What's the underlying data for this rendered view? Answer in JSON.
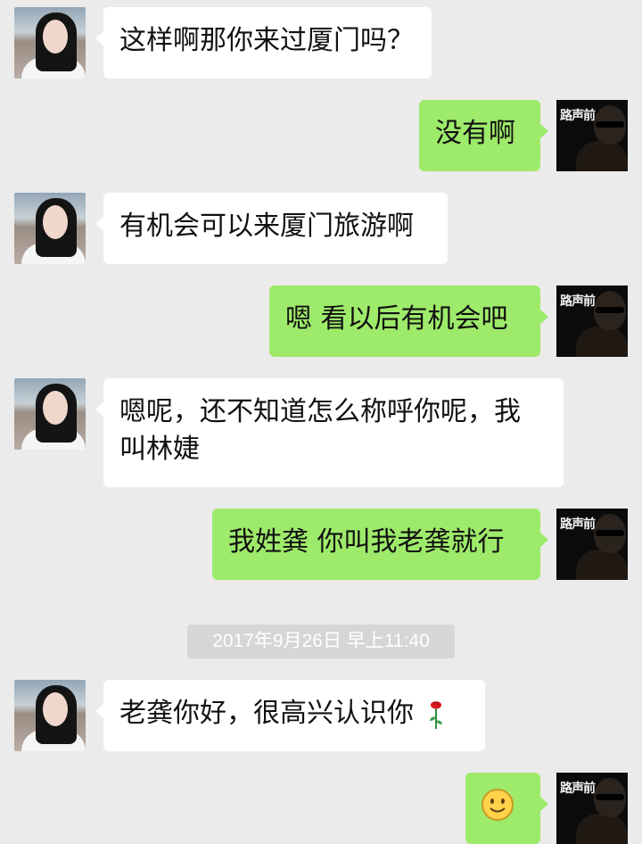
{
  "messages": [
    {
      "side": "in",
      "text": "这样啊那你来过厦门吗？"
    },
    {
      "side": "out",
      "text": "没有啊"
    },
    {
      "side": "in",
      "text": "有机会可以来厦门旅游啊"
    },
    {
      "side": "out",
      "text": "嗯 看以后有机会吧"
    },
    {
      "side": "in",
      "line1": "嗯呢，还不知道怎么称呼你呢，我",
      "line2": "叫林婕"
    },
    {
      "side": "out",
      "text": "我姓龚  你叫我老龚就行"
    },
    {
      "side": "in",
      "text": "老龚你好，很高兴认识你",
      "emoji": "rose-icon"
    },
    {
      "side": "out",
      "emoji": "smiley-face-icon"
    }
  ],
  "timestamp": "2017年9月26日 早上11:40",
  "colors": {
    "background": "#ebebeb",
    "incoming_bubble": "#ffffff",
    "outgoing_bubble": "#9eea6a",
    "timestamp_bg": "#d6d6d6"
  }
}
